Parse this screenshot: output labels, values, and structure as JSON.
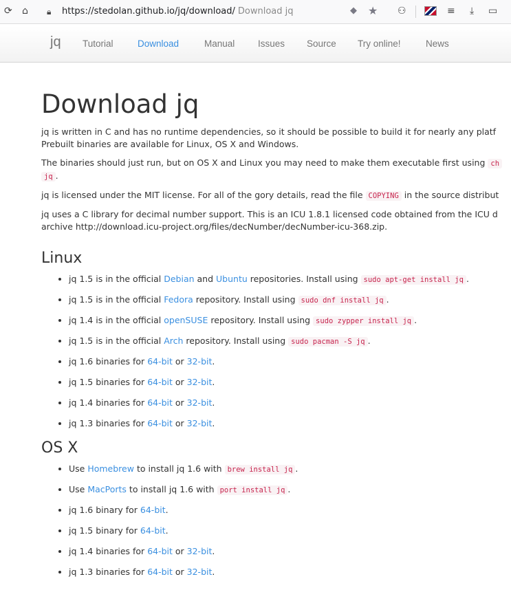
{
  "browser": {
    "url": "https://stedolan.github.io/jq/download/",
    "tab_title": "Download jq"
  },
  "nav": {
    "brand": "jq",
    "items": [
      "Tutorial",
      "Download",
      "Manual",
      "Issues",
      "Source",
      "Try online!",
      "News"
    ],
    "active": "Download"
  },
  "page": {
    "title": "Download jq",
    "intro": [
      [
        "jq is written in C and has no runtime dependencies, so it should be possible to build it for nearly any platf",
        "Prebuilt binaries are available for Linux, OS X and Windows."
      ],
      [
        "The binaries should just run, but on OS X and Linux you may need to make them executable first using "
      ],
      [
        "jq is licensed under the MIT license. For all of the gory details, read the file ",
        " in the source distribut"
      ],
      [
        "jq uses a C library for decimal number support. This is an ICU 1.8.1 licensed code obtained from the ICU d",
        "archive http://download.icu-project.org/files/decNumber/decNumber-icu-368.zip."
      ]
    ],
    "p2_code_1": "ch",
    "p2_code_2": "jq",
    "p3_code": "COPYING"
  },
  "linux": {
    "heading": "Linux",
    "repos": [
      {
        "pre": "jq 1.5 is in the official ",
        "link1": "Debian",
        "mid": " and ",
        "link2": "Ubuntu",
        "post": " repositories. Install using ",
        "code": "sudo apt-get install jq",
        "end": "."
      },
      {
        "pre": "jq 1.5 is in the official ",
        "link1": "Fedora",
        "post": " repository. Install using ",
        "code": "sudo dnf install jq",
        "end": "."
      },
      {
        "pre": "jq 1.4 is in the official ",
        "link1": "openSUSE",
        "post": " repository. Install using ",
        "code": "sudo zypper install jq",
        "end": "."
      },
      {
        "pre": "jq 1.5 is in the official ",
        "link1": "Arch",
        "post": " repository. Install using ",
        "code": "sudo pacman -S jq",
        "end": "."
      }
    ],
    "binaries": [
      {
        "pre": "jq 1.6 binaries for ",
        "l64": "64-bit",
        "or": " or ",
        "l32": "32-bit",
        "end": "."
      },
      {
        "pre": "jq 1.5 binaries for ",
        "l64": "64-bit",
        "or": " or ",
        "l32": "32-bit",
        "end": "."
      },
      {
        "pre": "jq 1.4 binaries for ",
        "l64": "64-bit",
        "or": " or ",
        "l32": "32-bit",
        "end": "."
      },
      {
        "pre": "jq 1.3 binaries for ",
        "l64": "64-bit",
        "or": " or ",
        "l32": "32-bit",
        "end": "."
      }
    ]
  },
  "osx": {
    "heading": "OS X",
    "managers": [
      {
        "pre": "Use ",
        "link": "Homebrew",
        "post": " to install jq 1.6 with ",
        "code": "brew install jq",
        "end": "."
      },
      {
        "pre": "Use ",
        "link": "MacPorts",
        "post": " to install jq 1.6 with ",
        "code": "port install jq",
        "end": "."
      }
    ],
    "binaries": [
      {
        "pre": "jq 1.6 binary for ",
        "l64": "64-bit",
        "end": "."
      },
      {
        "pre": "jq 1.5 binary for ",
        "l64": "64-bit",
        "end": "."
      },
      {
        "pre": "jq 1.4 binaries for ",
        "l64": "64-bit",
        "or": " or ",
        "l32": "32-bit",
        "end": "."
      },
      {
        "pre": "jq 1.3 binaries for ",
        "l64": "64-bit",
        "or": " or ",
        "l32": "32-bit",
        "end": "."
      }
    ]
  }
}
